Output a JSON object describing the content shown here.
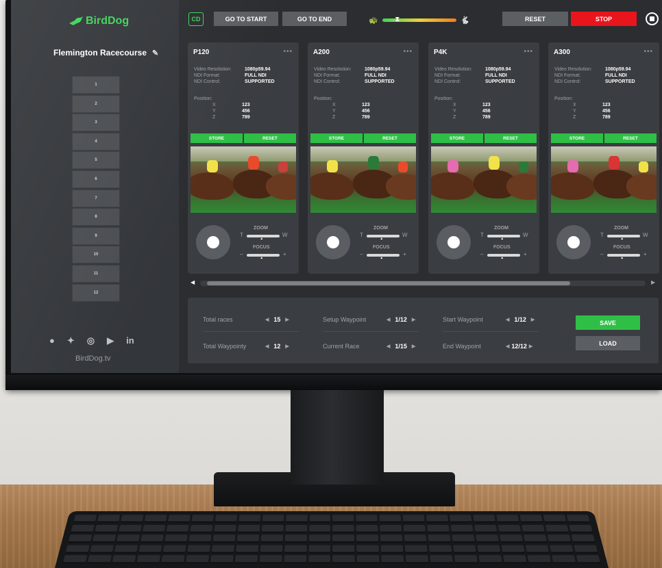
{
  "brand": {
    "name": "BirdDog",
    "website": "BirdDog.tv",
    "accent": "#3fd45a"
  },
  "sidebar": {
    "venue": "Flemington Racecourse",
    "presets": [
      "1",
      "2",
      "3",
      "4",
      "5",
      "6",
      "7",
      "8",
      "9",
      "10",
      "11",
      "12"
    ],
    "social_icons": [
      "facebook-icon",
      "twitter-icon",
      "instagram-icon",
      "youtube-icon",
      "linkedin-icon"
    ],
    "linkedin_text": "in"
  },
  "toolbar": {
    "cd_label": "CD",
    "go_to_start": "GO TO START",
    "go_to_end": "GO TO END",
    "speed_level": 0.2,
    "reset": "RESET",
    "stop": "STOP",
    "stop_color": "#e8151d"
  },
  "labels": {
    "video_resolution": "Video Resolution:",
    "ndi_format": "NDI Format:",
    "ndi_control": "NDI Control:",
    "position": "Position:",
    "x": "X",
    "y": "Y",
    "z": "Z",
    "store": "STORE",
    "reset": "RESET",
    "zoom": "ZOOM",
    "focus": "FOCUS",
    "tele": "T",
    "wide": "W",
    "minus": "–",
    "plus": "+",
    "menu": "•••"
  },
  "cameras": [
    {
      "name": "P120",
      "resolution": "1080p59.94",
      "ndi_format": "FULL NDI",
      "ndi_control": "SUPPORTED",
      "x": "123",
      "y": "456",
      "z": "789"
    },
    {
      "name": "A200",
      "resolution": "1080p59.94",
      "ndi_format": "FULL NDI",
      "ndi_control": "SUPPORTED",
      "x": "123",
      "y": "456",
      "z": "789"
    },
    {
      "name": "P4K",
      "resolution": "1080p59.94",
      "ndi_format": "FULL NDI",
      "ndi_control": "SUPPORTED",
      "x": "123",
      "y": "456",
      "z": "789"
    },
    {
      "name": "A300",
      "resolution": "1080p59.94",
      "ndi_format": "FULL NDI",
      "ndi_control": "SUPPORTED",
      "x": "123",
      "y": "456",
      "z": "789"
    }
  ],
  "race_panel": {
    "total_races": {
      "label": "Total races",
      "value": "15"
    },
    "total_waypoints": {
      "label": "Total Waypointy",
      "value": "12"
    },
    "setup_waypoint": {
      "label": "Setup Waypoint",
      "value": "1/12"
    },
    "current_race": {
      "label": "Current Race",
      "value": "1/15"
    },
    "start_waypoint": {
      "label": "Start Waypoint",
      "value": "1/12"
    },
    "end_waypoint": {
      "label": "End Waypoint",
      "value": "12/12"
    },
    "save": "SAVE",
    "load": "LOAD"
  }
}
